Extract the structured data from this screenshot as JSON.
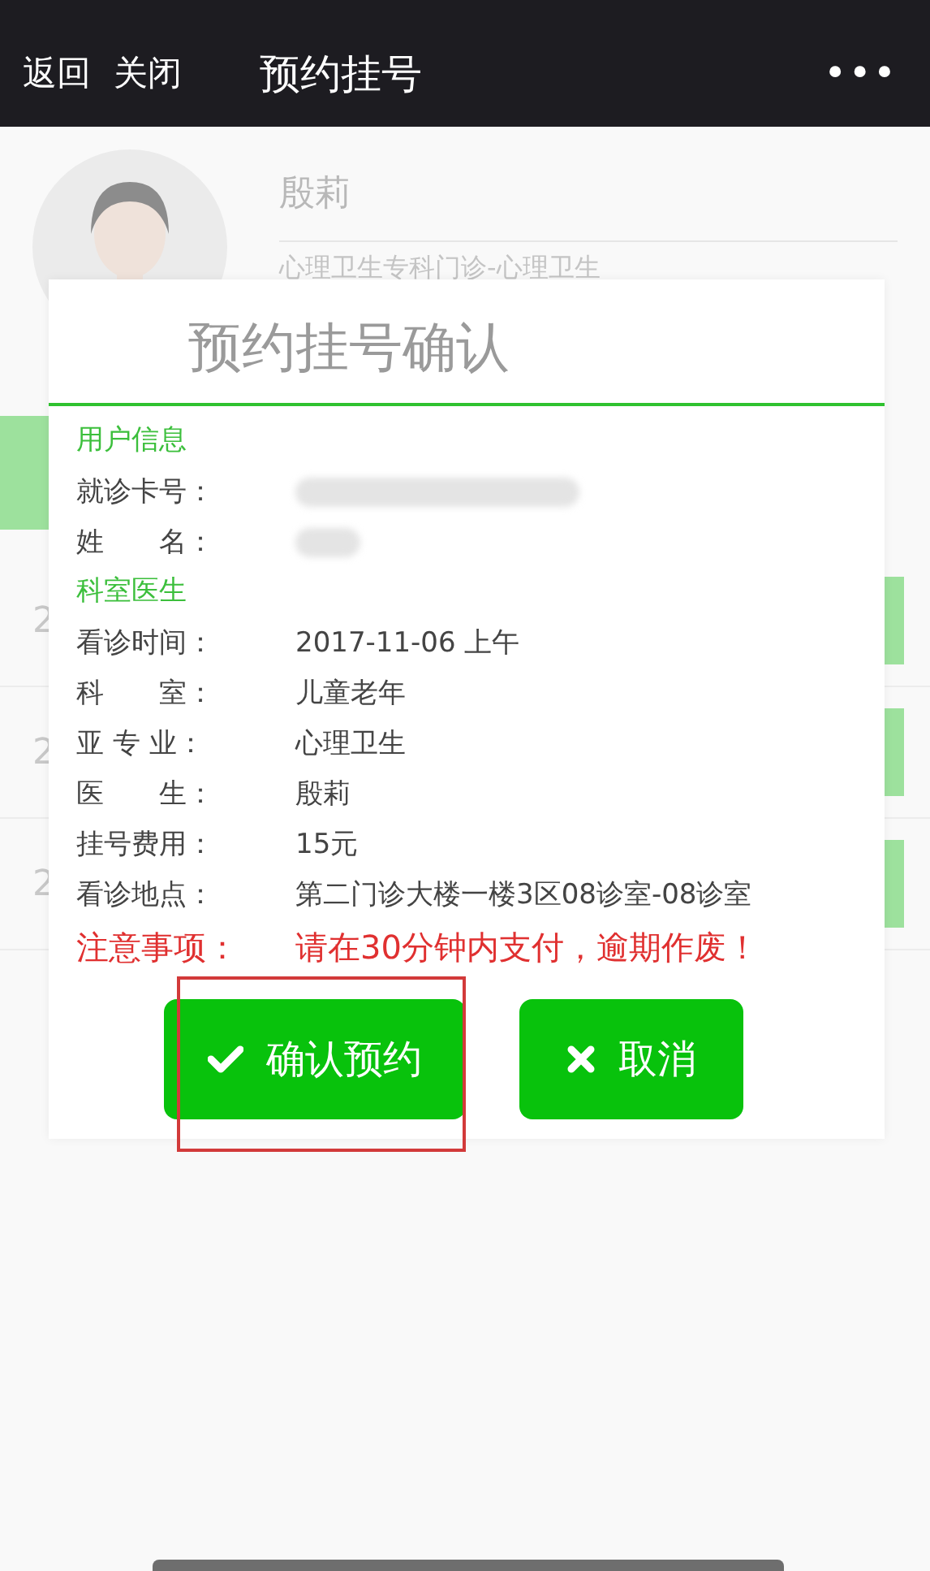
{
  "nav": {
    "back": "返回",
    "close": "关闭",
    "title": "预约挂号",
    "more": "•••"
  },
  "doctor": {
    "name": "殷莉",
    "department": "心理卫生专科门诊-心理卫生"
  },
  "background_rows": [
    {
      "column_1": "2"
    },
    {
      "column_1": "2"
    },
    {
      "column_1": "2"
    }
  ],
  "dialog": {
    "title": "预约挂号确认",
    "sections": [
      {
        "heading": "用户信息",
        "fields": [
          {
            "label": "就诊卡号：",
            "redacted": true
          },
          {
            "label": "姓　　名：",
            "redacted": true
          }
        ]
      },
      {
        "heading": "科室医生",
        "fields": [
          {
            "label": "看诊时间：",
            "value": "2017-11-06 上午"
          },
          {
            "label": "科　　室：",
            "value": "儿童老年"
          },
          {
            "label": "亚 专 业：",
            "value": "心理卫生"
          },
          {
            "label": "医　　生：",
            "value": "殷莉"
          },
          {
            "label": "挂号费用：",
            "value": "15元"
          },
          {
            "label": "看诊地点：",
            "value": "第二门诊大楼一楼3区08诊室-08诊室"
          }
        ]
      }
    ],
    "notice": {
      "label": "注意事项：",
      "text": "请在30分钟内支付，逾期作废！"
    },
    "buttons": [
      {
        "kind": "confirm",
        "label": "确认预约",
        "highlighted": true
      },
      {
        "kind": "cancel",
        "label": "取消",
        "highlighted": false
      }
    ]
  }
}
